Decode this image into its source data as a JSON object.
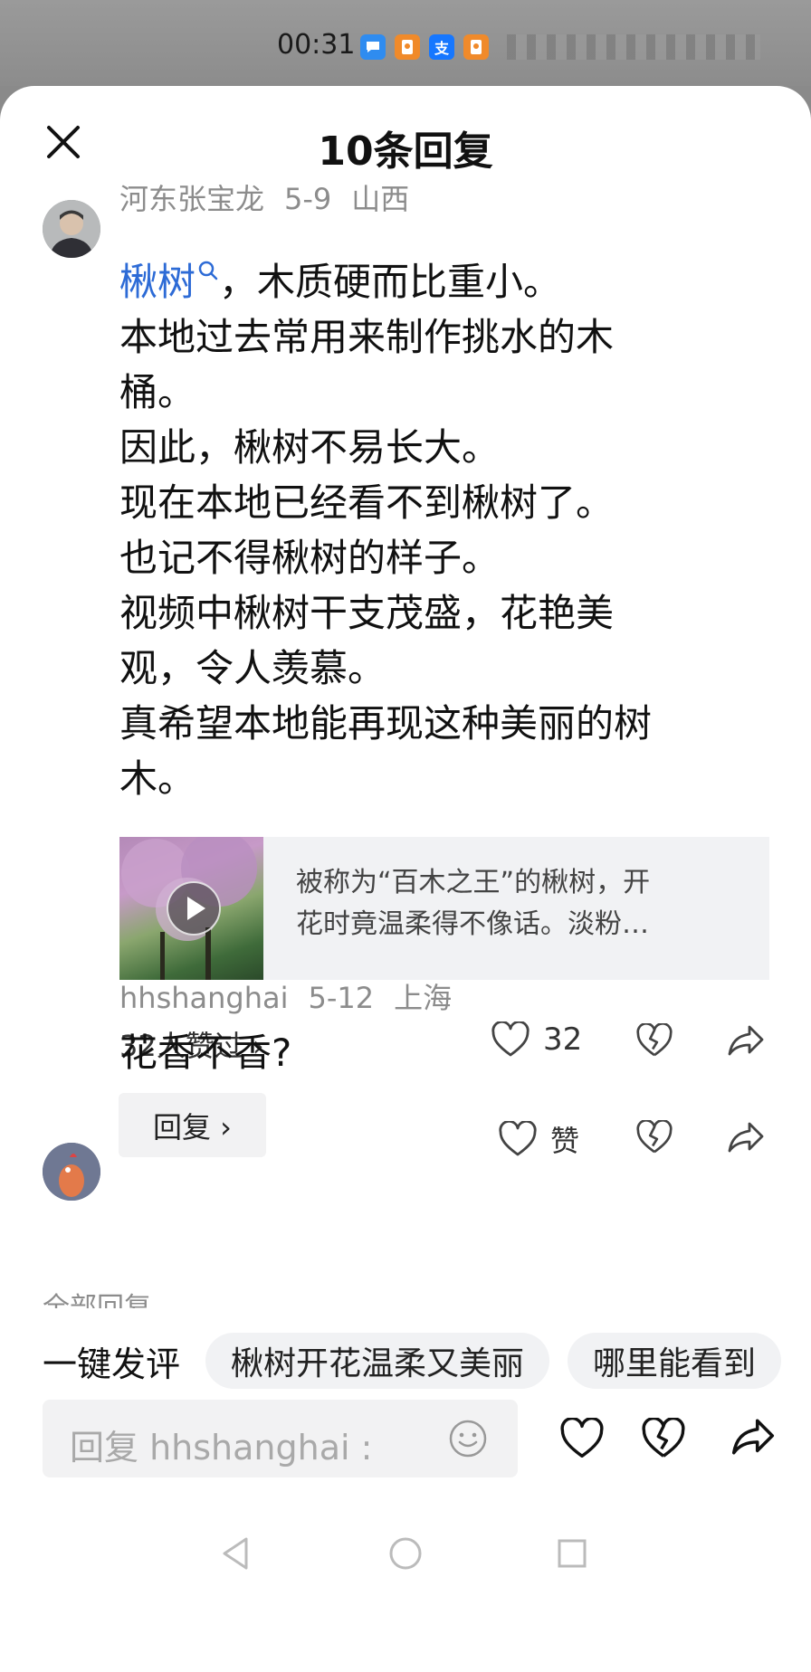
{
  "status_bar": {
    "time": "00:31",
    "app_icons": [
      "chat-icon",
      "red-packet-icon",
      "alipay-icon",
      "red-packet-icon"
    ],
    "alipay_glyph": "支"
  },
  "sheet": {
    "title": "10条回复",
    "close_icon": "close-icon"
  },
  "main_comment": {
    "author": "河东张宝龙",
    "date": "5-9",
    "location": "山西",
    "highlight_word": "楸树",
    "lines": [
      "，木质硬而比重小。",
      "本地过去常用来制作挑水的木",
      "桶。",
      "因此，楸树不易长大。",
      "现在本地已经看不到楸树了。",
      "也记不得楸树的样子。",
      "视频中楸树干支茂盛，花艳美",
      "观，令人羡慕。",
      "真希望本地能再现这种美丽的树",
      "木。"
    ],
    "video_card": {
      "line1": "被称为“百木之王”的楸树，开",
      "line2": "花时竟温柔得不像话。淡粉…"
    },
    "liked_summary": "32人赞过 ›",
    "like_count": "32"
  },
  "reply": {
    "author": "hhshanghai",
    "date": "5-12",
    "location": "上海",
    "text": "花香不香?",
    "reply_button": "回复 ›",
    "like_label": "赞"
  },
  "all_replies_label": "全部回复",
  "suggestions": {
    "label": "一键发评",
    "chips": [
      "楸树开花温柔又美丽",
      "哪里能看到"
    ]
  },
  "composer": {
    "placeholder": "回复 hhshanghai :"
  },
  "colors": {
    "accent_blue": "#2d6bd6",
    "meta_gray": "#8c8c8c",
    "chip_bg": "#f1f2f4"
  }
}
